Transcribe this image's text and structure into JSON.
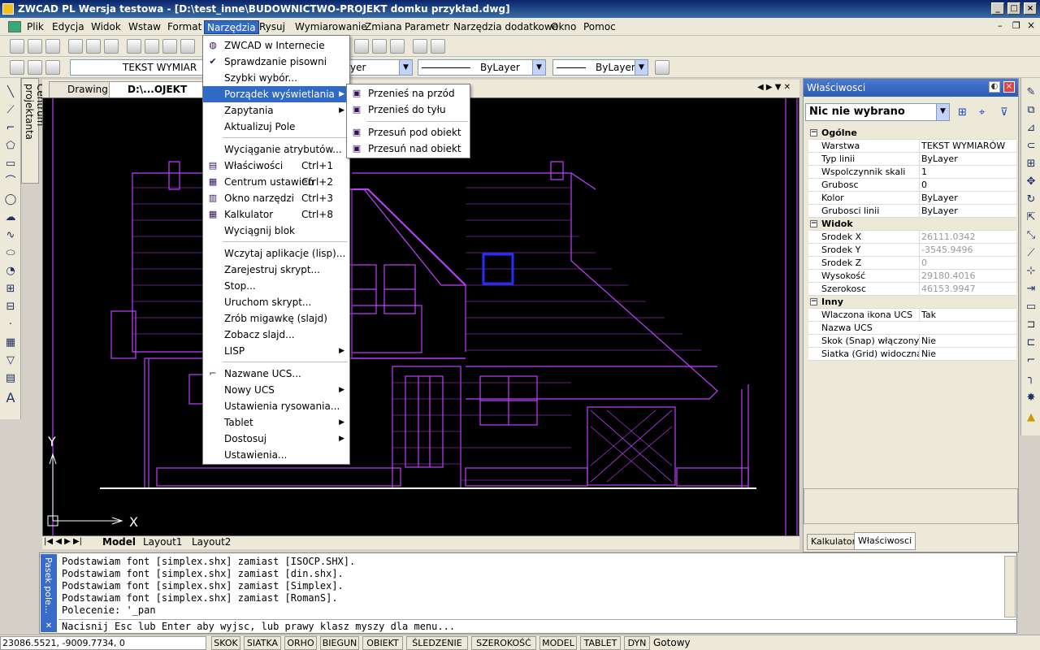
{
  "window": {
    "title": "ZWCAD PL Wersja testowa - [D:\\test_inne\\BUDOWNICTWO-PROJEKT domku przykład.dwg]"
  },
  "menubar": [
    "Plik",
    "Edycja",
    "Widok",
    "Wstaw",
    "Format",
    "Narzędzia",
    "Rysuj",
    "Wymiarowanie",
    "Zmiana",
    "Parametr",
    "Narzędzia dodatkowe",
    "Okno",
    "Pomoc"
  ],
  "toolbar2": {
    "text_style": "TEKST WYMIAR",
    "layer": "yer",
    "linetype": "ByLayer",
    "lineweight": "ByLayer"
  },
  "centrum_label": "Centrum projektanta",
  "doc_tabs": [
    "Drawing1",
    "D:\\...OJEKT domk"
  ],
  "layout_tabs": [
    "Model",
    "Layout1",
    "Layout2"
  ],
  "tools_menu": {
    "items": [
      {
        "label": "ZWCAD w Internecie",
        "icon": "globe-icon"
      },
      {
        "label": "Sprawdzanie pisowni",
        "icon": "spellcheck-icon"
      },
      {
        "label": "Szybki wybór...",
        "icon": ""
      },
      {
        "label": "Porządek wyświetlania",
        "submenu": true,
        "highlight": true
      },
      {
        "label": "Zapytania",
        "submenu": true
      },
      {
        "label": "Aktualizuj Pole"
      },
      {
        "label": "Wyciąganie atrybutów..."
      },
      {
        "label": "Właściwości",
        "shortcut": "Ctrl+1",
        "icon": "properties-icon"
      },
      {
        "label": "Centrum ustawień",
        "shortcut": "Ctrl+2",
        "icon": "design-center-icon"
      },
      {
        "label": "Okno narzędzi",
        "shortcut": "Ctrl+3",
        "icon": "tool-palette-icon"
      },
      {
        "label": "Kalkulator",
        "shortcut": "Ctrl+8",
        "icon": "calculator-icon"
      },
      {
        "label": "Wyciągnij blok"
      },
      {
        "label": "Wczytaj aplikacje (lisp)..."
      },
      {
        "label": "Zarejestruj skrypt..."
      },
      {
        "label": "Stop..."
      },
      {
        "label": "Uruchom skrypt..."
      },
      {
        "label": "Zrób migawkę (slajd)"
      },
      {
        "label": "Zobacz slajd..."
      },
      {
        "label": "LISP",
        "submenu": true
      },
      {
        "label": "Nazwane UCS...",
        "icon": "ucs-icon"
      },
      {
        "label": "Nowy UCS",
        "submenu": true
      },
      {
        "label": "Ustawienia rysowania..."
      },
      {
        "label": "Tablet",
        "submenu": true
      },
      {
        "label": "Dostosuj",
        "submenu": true
      },
      {
        "label": "Ustawienia..."
      }
    ]
  },
  "draworder_menu": [
    "Przenieś na przód",
    "Przenieś do tyłu",
    "Przesuń pod obiekt",
    "Przesuń nad obiekt"
  ],
  "properties": {
    "title": "Właściwosci",
    "selection": "Nic nie wybrano",
    "groups": [
      {
        "name": "Ogólne",
        "rows": [
          [
            "Warstwa",
            "TEKST WYMIARÓW"
          ],
          [
            "Typ linii",
            "ByLayer"
          ],
          [
            "Wspolczynnik skali",
            "1"
          ],
          [
            "Grubosc",
            "0"
          ],
          [
            "Kolor",
            "ByLayer"
          ],
          [
            "Grubosci linii",
            "ByLayer"
          ]
        ]
      },
      {
        "name": "Widok",
        "rows": [
          [
            "Srodek X",
            "26111.0342"
          ],
          [
            "Srodek Y",
            "-3545.9496"
          ],
          [
            "Srodek Z",
            "0"
          ],
          [
            "Wysokość",
            "29180.4016"
          ],
          [
            "Szerokosc",
            "46153.9947"
          ]
        ]
      },
      {
        "name": "Inny",
        "rows": [
          [
            "Wlaczona ikona UCS",
            "Tak"
          ],
          [
            "Nazwa UCS",
            ""
          ],
          [
            "Skok (Snap) włączony",
            "Nie"
          ],
          [
            "Siatka (Grid) widoczna",
            "Nie"
          ]
        ]
      }
    ],
    "tabs": [
      "Kalkulator",
      "Właściwosci"
    ]
  },
  "command": {
    "side_label": "Pasek pole...",
    "lines": [
      "Podstawiam font [simplex.shx] zamiast [ISOCP.SHX].",
      "Podstawiam font [simplex.shx] zamiast [din.shx].",
      "Podstawiam font [simplex.shx] zamiast [Simplex].",
      "Podstawiam font [simplex.shx] zamiast [RomanS].",
      "Polecenie: '_pan"
    ],
    "prompt": "Nacisnij Esc lub Enter aby wyjsc, lub prawy klasz myszy dla menu..."
  },
  "status": {
    "coords": "23086.5521,  -9009.7734,  0",
    "buttons": [
      "SKOK",
      "SIATKA",
      "ORHO",
      "BIEGUN",
      "OBIEKT",
      "ŚLEDZENIE",
      "SZEROKOŚĆ",
      "MODEL",
      "TABLET",
      "DYN"
    ],
    "state": "Gotowy"
  },
  "axes": {
    "x": "X",
    "y": "Y"
  },
  "colors": {
    "drawing": "#c040ff",
    "title_bar": "#0a246a",
    "highlight": "#316ac5"
  }
}
